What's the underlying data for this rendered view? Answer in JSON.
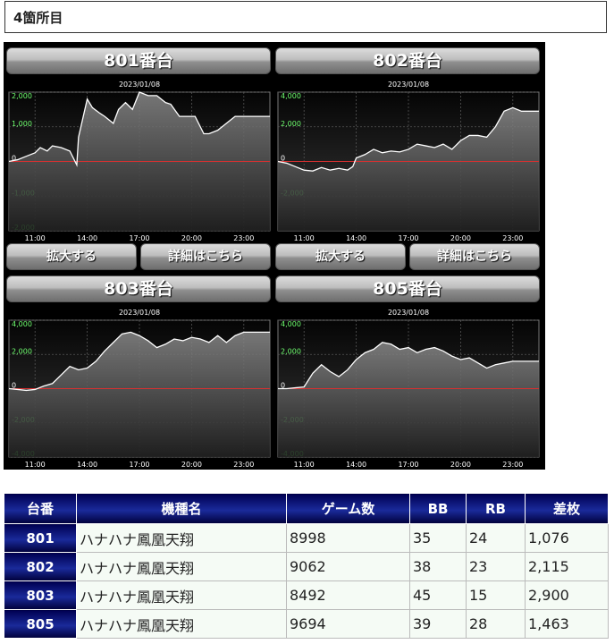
{
  "heading": "4箇所目",
  "buttons": {
    "zoom": "拡大する",
    "details": "詳細はこちら"
  },
  "colors": {
    "line": "#ffffff",
    "area_top": "#8a8a8a",
    "area_bottom": "#1a1a1a",
    "zero_line": "#d83030",
    "positive_tick": "#6fff6f",
    "negative_tick": "#6fff6f",
    "x_tick": "#ffffff"
  },
  "chart_data": [
    {
      "type": "area",
      "title": "801番台",
      "subtitle": "2023/01/08",
      "x_ticks": [
        "11:00",
        "14:00",
        "17:00",
        "20:00",
        "23:00"
      ],
      "y_ticks": [
        "2,000",
        "1,000",
        "0",
        "-1,000",
        "-2,000"
      ],
      "ylim": [
        -2000,
        2000
      ],
      "xlim": [
        9.5,
        24.5
      ],
      "grid": true,
      "x": [
        9.5,
        10.0,
        10.5,
        11.0,
        11.3,
        11.7,
        12.0,
        12.5,
        13.0,
        13.4,
        13.5,
        14.0,
        14.3,
        14.7,
        15.0,
        15.5,
        15.8,
        16.2,
        16.6,
        17.0,
        17.5,
        18.0,
        18.5,
        18.8,
        19.3,
        19.7,
        20.2,
        20.7,
        21.0,
        21.5,
        22.0,
        22.5,
        23.0,
        23.5,
        24.0,
        24.5
      ],
      "y": [
        0,
        50,
        150,
        250,
        400,
        300,
        450,
        400,
        300,
        -100,
        700,
        1800,
        1550,
        1400,
        1300,
        1100,
        1500,
        1700,
        1500,
        2000,
        1900,
        1900,
        1700,
        1650,
        1300,
        1300,
        1300,
        800,
        800,
        900,
        1100,
        1300,
        1300,
        1300,
        1300,
        1300
      ]
    },
    {
      "type": "area",
      "title": "802番台",
      "subtitle": "2023/01/08",
      "x_ticks": [
        "11:00",
        "14:00",
        "17:00",
        "20:00",
        "23:00"
      ],
      "y_ticks": [
        "4,000",
        "2,000",
        "0",
        "-2,000"
      ],
      "ylim": [
        -4000,
        4000
      ],
      "xlim": [
        9.5,
        24.5
      ],
      "grid": true,
      "x": [
        9.5,
        10.0,
        10.5,
        11.0,
        11.5,
        12.0,
        12.5,
        13.0,
        13.5,
        13.8,
        14.0,
        14.5,
        15.0,
        15.5,
        16.0,
        16.5,
        17.0,
        17.5,
        18.0,
        18.5,
        19.0,
        19.5,
        20.0,
        20.5,
        21.0,
        21.5,
        22.0,
        22.5,
        23.0,
        23.5,
        24.0,
        24.5
      ],
      "y": [
        0,
        -100,
        -300,
        -500,
        -550,
        -350,
        -500,
        -400,
        -500,
        -300,
        200,
        400,
        700,
        500,
        600,
        550,
        700,
        1000,
        900,
        800,
        1000,
        700,
        1200,
        1500,
        1500,
        1400,
        2000,
        2900,
        3100,
        2900,
        2900,
        2900
      ]
    },
    {
      "type": "area",
      "title": "803番台",
      "subtitle": "2023/01/08",
      "x_ticks": [
        "11:00",
        "14:00",
        "17:00",
        "20:00",
        "23:00"
      ],
      "y_ticks": [
        "4,000",
        "2,000",
        "0",
        "-2,000",
        "-4,000"
      ],
      "ylim": [
        -4000,
        4000
      ],
      "xlim": [
        9.5,
        24.5
      ],
      "grid": true,
      "x": [
        9.5,
        10.0,
        10.5,
        11.0,
        11.5,
        12.0,
        12.5,
        13.0,
        13.5,
        14.0,
        14.5,
        15.0,
        15.5,
        16.0,
        16.5,
        17.0,
        17.5,
        18.0,
        18.5,
        19.0,
        19.5,
        20.0,
        20.5,
        21.0,
        21.5,
        22.0,
        22.5,
        23.0,
        23.5,
        24.0,
        24.5
      ],
      "y": [
        0,
        -50,
        -100,
        -50,
        150,
        300,
        800,
        1300,
        1100,
        1200,
        1600,
        2200,
        2700,
        3200,
        3300,
        3100,
        2800,
        2400,
        2600,
        2900,
        2800,
        3000,
        2900,
        2700,
        3100,
        2700,
        3100,
        3300,
        3300,
        3300,
        3300
      ]
    },
    {
      "type": "area",
      "title": "805番台",
      "subtitle": "2023/01/08",
      "x_ticks": [
        "11:00",
        "14:00",
        "17:00",
        "20:00",
        "23:00"
      ],
      "y_ticks": [
        "4,000",
        "2,000",
        "0",
        "-2,000",
        "-4,000"
      ],
      "ylim": [
        -4000,
        4000
      ],
      "xlim": [
        9.5,
        24.5
      ],
      "grid": true,
      "x": [
        9.5,
        10.0,
        10.5,
        11.0,
        11.5,
        12.0,
        12.5,
        13.0,
        13.5,
        14.0,
        14.5,
        15.0,
        15.5,
        16.0,
        16.5,
        17.0,
        17.5,
        18.0,
        18.5,
        19.0,
        19.5,
        20.0,
        20.5,
        21.0,
        21.5,
        22.0,
        22.5,
        23.0,
        23.5,
        24.0,
        24.5
      ],
      "y": [
        0,
        0,
        50,
        100,
        900,
        1400,
        1000,
        700,
        1100,
        1700,
        2100,
        2300,
        2700,
        2600,
        2300,
        2400,
        2100,
        2300,
        2400,
        2200,
        1900,
        1700,
        1800,
        1500,
        1200,
        1400,
        1500,
        1600,
        1600,
        1600,
        1600
      ]
    }
  ],
  "table": {
    "headers": [
      "台番",
      "機種名",
      "ゲーム数",
      "BB",
      "RB",
      "差枚"
    ],
    "rows": [
      [
        "801",
        "ハナハナ鳳凰天翔",
        "8998",
        "35",
        "24",
        "1,076"
      ],
      [
        "802",
        "ハナハナ鳳凰天翔",
        "9062",
        "38",
        "23",
        "2,115"
      ],
      [
        "803",
        "ハナハナ鳳凰天翔",
        "8492",
        "45",
        "15",
        "2,900"
      ],
      [
        "805",
        "ハナハナ鳳凰天翔",
        "9694",
        "39",
        "28",
        "1,463"
      ]
    ]
  }
}
